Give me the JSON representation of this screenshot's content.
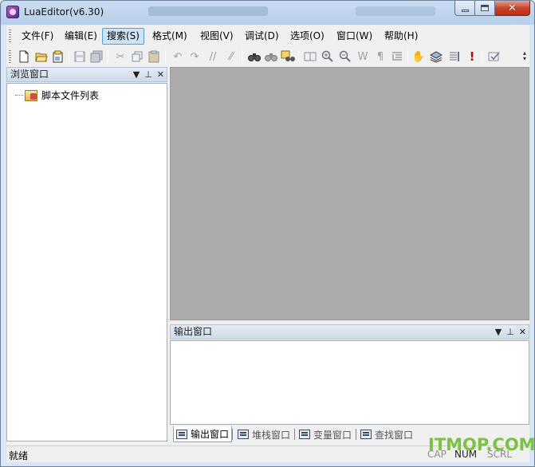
{
  "window": {
    "title": "LuaEditor(v6.30)"
  },
  "menu": {
    "items": [
      {
        "label": "文件(F)"
      },
      {
        "label": "编辑(E)"
      },
      {
        "label": "搜索(S)",
        "active": true
      },
      {
        "label": "格式(M)"
      },
      {
        "label": "视图(V)"
      },
      {
        "label": "调试(D)"
      },
      {
        "label": "选项(O)"
      },
      {
        "label": "窗口(W)"
      },
      {
        "label": "帮助(H)"
      }
    ]
  },
  "toolbar": {
    "icons": [
      "new-file-icon",
      "open-folder-icon",
      "open-project-icon",
      "save-icon",
      "save-all-icon",
      "cut-icon",
      "copy-icon",
      "paste-icon",
      "undo-icon",
      "redo-icon",
      "comment-icon",
      "uncomment-icon",
      "find-icon",
      "find-next-icon",
      "find-in-files-icon",
      "bookmark-icon",
      "zoom-in-icon",
      "zoom-out-icon",
      "word-wrap-icon",
      "pilcrow-icon",
      "indent-icon",
      "hand-icon",
      "layers-icon",
      "list-icon",
      "error-icon",
      "check-icon"
    ]
  },
  "browse_pane": {
    "title": "浏览窗口",
    "tree_root": "脚本文件列表"
  },
  "output_pane": {
    "title": "输出窗口"
  },
  "bottom_tabs": [
    {
      "label": "输出窗口",
      "active": true
    },
    {
      "label": "堆栈窗口"
    },
    {
      "label": "变量窗口"
    },
    {
      "label": "查找窗口"
    }
  ],
  "status": {
    "text": "就绪",
    "cap": "CAP",
    "num": "NUM",
    "scrl": "SCRL"
  },
  "watermark": "ITMOP.COM",
  "colors": {
    "editor_bg": "#ababab",
    "watermark": "#7cc242",
    "close_button": "#c7442b"
  }
}
